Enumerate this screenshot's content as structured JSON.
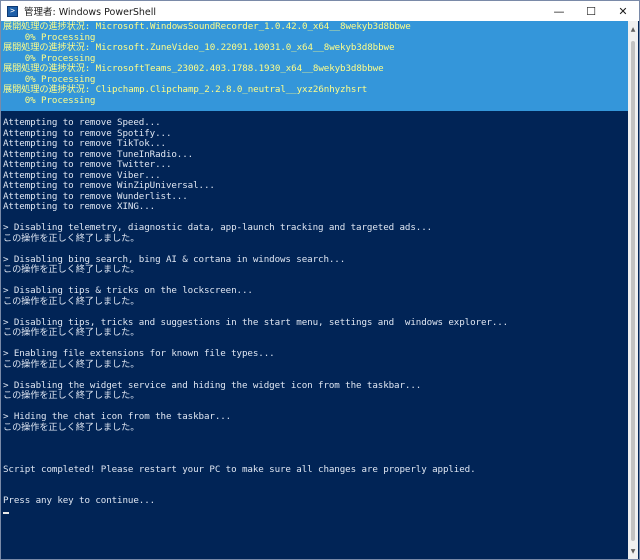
{
  "window": {
    "title": "管理者: Windows PowerShell",
    "app_icon": "powershell-icon",
    "controls": {
      "minimize": "—",
      "maximize": "☐",
      "close": "✕"
    }
  },
  "progress": [
    {
      "status": "展開処理の進捗状況: Microsoft.WindowsSoundRecorder_1.0.42.0_x64__8wekyb3d8bbwe",
      "percent": "    0% Processing"
    },
    {
      "status": "展開処理の進捗状況: Microsoft.ZuneVideo_10.22091.10031.0_x64__8wekyb3d8bbwe",
      "percent": "    0% Processing"
    },
    {
      "status": "展開処理の進捗状況: MicrosoftTeams_23002.403.1788.1930_x64__8wekyb3d8bbwe",
      "percent": "    0% Processing"
    },
    {
      "status": "展開処理の進捗状況: Clipchamp.Clipchamp_2.2.8.0_neutral__yxz26nhyzhsrt",
      "percent": "    0% Processing"
    }
  ],
  "console_lines": [
    "Attempting to remove Speed...",
    "Attempting to remove Spotify...",
    "Attempting to remove TikTok...",
    "Attempting to remove TuneInRadio...",
    "Attempting to remove Twitter...",
    "Attempting to remove Viber...",
    "Attempting to remove WinZipUniversal...",
    "Attempting to remove Wunderlist...",
    "Attempting to remove XING...",
    "",
    "> Disabling telemetry, diagnostic data, app-launch tracking and targeted ads...",
    "この操作を正しく終了しました。",
    "",
    "> Disabling bing search, bing AI & cortana in windows search...",
    "この操作を正しく終了しました。",
    "",
    "> Disabling tips & tricks on the lockscreen...",
    "この操作を正しく終了しました。",
    "",
    "> Disabling tips, tricks and suggestions in the start menu, settings and  windows explorer...",
    "この操作を正しく終了しました。",
    "",
    "> Enabling file extensions for known file types...",
    "この操作を正しく終了しました。",
    "",
    "> Disabling the widget service and hiding the widget icon from the taskbar...",
    "この操作を正しく終了しました。",
    "",
    "> Hiding the chat icon from the taskbar...",
    "この操作を正しく終了しました。",
    "",
    "",
    "",
    "Script completed! Please restart your PC to make sure all changes are properly applied.",
    "",
    "",
    "Press any key to continue..."
  ],
  "colors": {
    "console_bg": "#012456",
    "progress_bg": "#3496da",
    "progress_text": "#fdfd8a",
    "console_text": "#dfe6f2"
  }
}
